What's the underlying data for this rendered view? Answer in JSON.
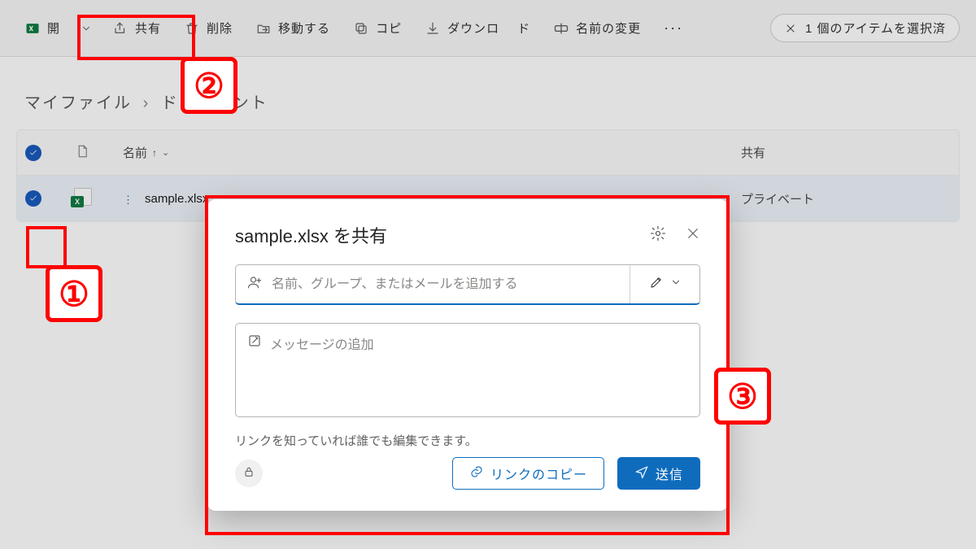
{
  "toolbar": {
    "open": "開",
    "share": "共有",
    "delete": "削除",
    "move": "移動する",
    "copy": "コピ",
    "download": "ダウンロ",
    "download_suffix": "ド",
    "rename": "名前の変更",
    "more": "···"
  },
  "selection_bar": {
    "text": "1 個のアイテムを選択済"
  },
  "breadcrumb": {
    "root": "マイファイル",
    "current": "ドキュメント"
  },
  "columns": {
    "name": "名前",
    "share": "共有"
  },
  "file": {
    "name": "sample.xlsx",
    "share_status": "プライベート"
  },
  "dialog": {
    "title": "sample.xlsx を共有",
    "recipient_placeholder": "名前、グループ、またはメールを追加する",
    "message_placeholder": "メッセージの追加",
    "link_info": "リンクを知っていれば誰でも編集できます。",
    "copy_link": "リンクのコピー",
    "send": "送信"
  },
  "annotations": {
    "n1": "①",
    "n2": "②",
    "n3": "③"
  }
}
